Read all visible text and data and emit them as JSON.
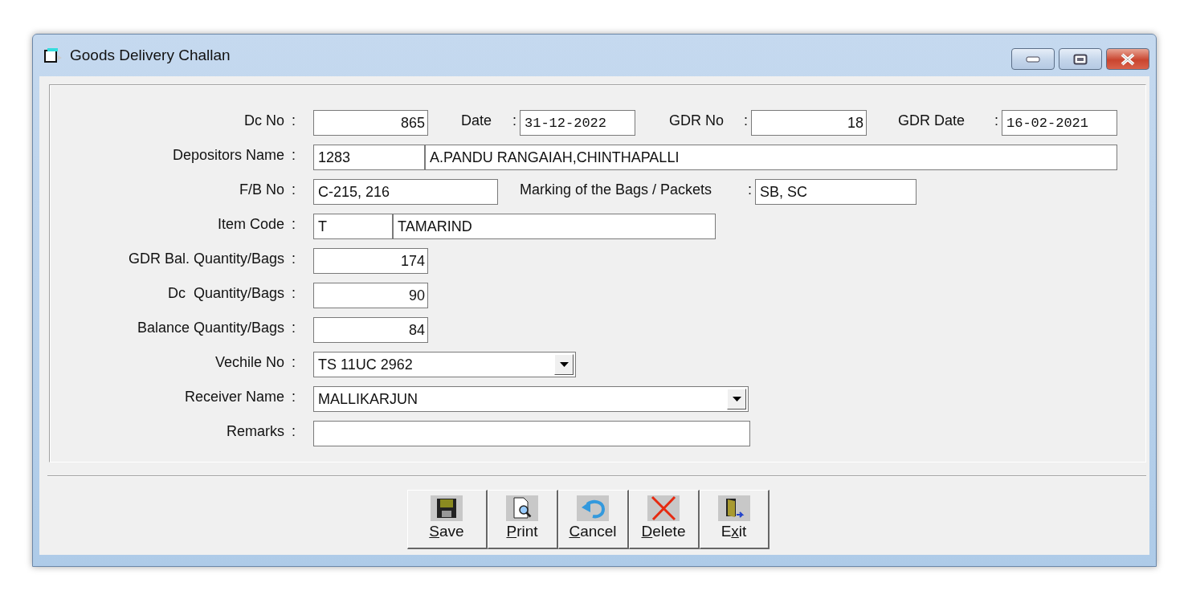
{
  "window": {
    "title": "Goods Delivery Challan"
  },
  "rows": [
    {
      "items": [
        {
          "kind": "label",
          "text": "Dc No",
          "colon": ":"
        },
        {
          "kind": "number",
          "value": "865"
        },
        {
          "kind": "label",
          "text": "Date",
          "colon": ":"
        },
        {
          "kind": "date",
          "value": "31-12-2022"
        },
        {
          "kind": "label",
          "text": "GDR No",
          "colon": ":"
        },
        {
          "kind": "number",
          "value": "18"
        },
        {
          "kind": "label",
          "text": "GDR Date",
          "colon": ":"
        },
        {
          "kind": "date",
          "value": "16-02-2021"
        }
      ]
    },
    {
      "items": [
        {
          "kind": "label",
          "text": "Depositors Name",
          "colon": ":"
        },
        {
          "kind": "text",
          "value": "1283"
        },
        {
          "kind": "text",
          "value": "A.PANDU RANGAIAH,CHINTHAPALLI"
        }
      ]
    },
    {
      "items": [
        {
          "kind": "label",
          "text": "F/B No",
          "colon": ":"
        },
        {
          "kind": "text",
          "value": "C-215, 216"
        },
        {
          "kind": "label",
          "text": "Marking of the Bags / Packets",
          "colon": ":"
        },
        {
          "kind": "text",
          "value": "SB, SC"
        }
      ]
    },
    {
      "items": [
        {
          "kind": "label",
          "text": "Item Code",
          "colon": ":"
        },
        {
          "kind": "text",
          "value": "T"
        },
        {
          "kind": "text",
          "value": "TAMARIND"
        }
      ]
    },
    {
      "items": [
        {
          "kind": "label",
          "text": "GDR Bal. Quantity/Bags",
          "colon": ":"
        },
        {
          "kind": "number",
          "value": "174"
        }
      ]
    },
    {
      "items": [
        {
          "kind": "label",
          "text": "Dc  Quantity/Bags",
          "colon": ":"
        },
        {
          "kind": "number",
          "value": "90"
        }
      ]
    },
    {
      "items": [
        {
          "kind": "label",
          "text": "Balance Quantity/Bags",
          "colon": ":"
        },
        {
          "kind": "number",
          "value": "84"
        }
      ]
    },
    {
      "items": [
        {
          "kind": "label",
          "text": "Vechile No",
          "colon": ":"
        },
        {
          "kind": "combo",
          "value": "TS 11UC 2962"
        }
      ]
    },
    {
      "items": [
        {
          "kind": "label",
          "text": "Receiver Name",
          "colon": ":"
        },
        {
          "kind": "combo",
          "value": "MALLIKARJUN"
        }
      ]
    },
    {
      "items": [
        {
          "kind": "label",
          "text": "Remarks",
          "colon": ":"
        },
        {
          "kind": "text"
        }
      ]
    }
  ],
  "buttons": [
    {
      "kind": "save",
      "key": "S",
      "after": "ave"
    },
    {
      "kind": "print",
      "key": "P",
      "after": "rint"
    },
    {
      "kind": "cancel",
      "key": "C",
      "after": "ancel"
    },
    {
      "kind": "delete",
      "key": "D",
      "after": "elete"
    },
    {
      "kind": "exit",
      "before": "E",
      "key": "x",
      "after": "it"
    }
  ]
}
